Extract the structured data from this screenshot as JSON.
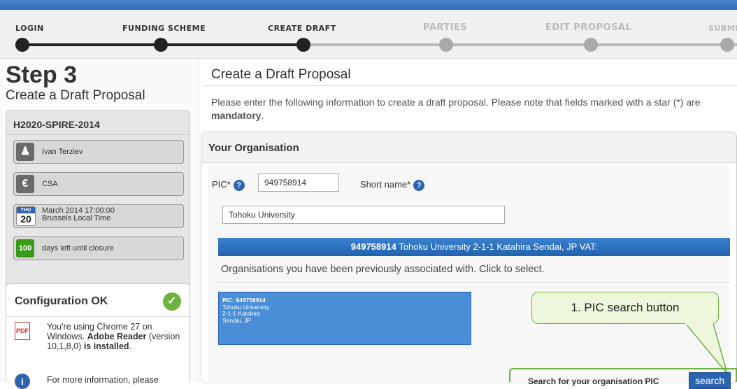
{
  "steps": [
    {
      "label": "LOGIN",
      "state": "done"
    },
    {
      "label": "FUNDING SCHEME",
      "state": "done"
    },
    {
      "label": "CREATE DRAFT",
      "state": "done"
    },
    {
      "label": "PARTIES",
      "state": "todo"
    },
    {
      "label": "EDIT PROPOSAL",
      "state": "todo"
    },
    {
      "label": "SUBMIT",
      "state": "todo"
    }
  ],
  "sidebar": {
    "step_heading": "Step 3",
    "step_subtitle": "Create a Draft Proposal",
    "call_id": "H2020-SPIRE-2014",
    "user_name": "Ivan Terziev",
    "scheme": "CSA",
    "deadline_day_abbr": "THU",
    "deadline_day": "20",
    "deadline_date": "March 2014 17:00:00",
    "deadline_tz": "Brussels Local Time",
    "days_left": "100",
    "days_left_text": "days left until closure",
    "config_title": "Configuration OK",
    "config_text_1": "You're using Chrome 27 on Windows.",
    "config_adobe": "Adobe Reader",
    "config_version": "(version 10,1,8,0)",
    "config_is": "is",
    "config_installed": "installed",
    "config_more": "For more information, please"
  },
  "main": {
    "title": "Create a Draft Proposal",
    "intro_text": "Please enter the following information to create a draft proposal. Please note that fields marked with a star (*) are",
    "intro_mandatory": "mandatory",
    "org_title": "Your Organisation",
    "pic_label": "PIC*",
    "pic_value": "949758914",
    "short_name_label": "Short name*",
    "org_name_value": "Tohoku University",
    "bar_pic": "949758914",
    "bar_text": "Tohoku University 2-1-1 Katahira Sendai, JP VAT:",
    "prev_text": "Organisations you have been previously associated with. Click to select.",
    "card_lines": [
      "PIC: 949758914",
      "Tohoku University",
      "2-1-1 Katahira",
      "Sendai, JP"
    ],
    "callout_text": "1. PIC search button",
    "search_label": "Search for your organisation PIC",
    "search_button": "search"
  },
  "colors": {
    "accent": "#2d64b1",
    "ok_green": "#6db33f",
    "days_green": "#3a9a1a"
  }
}
